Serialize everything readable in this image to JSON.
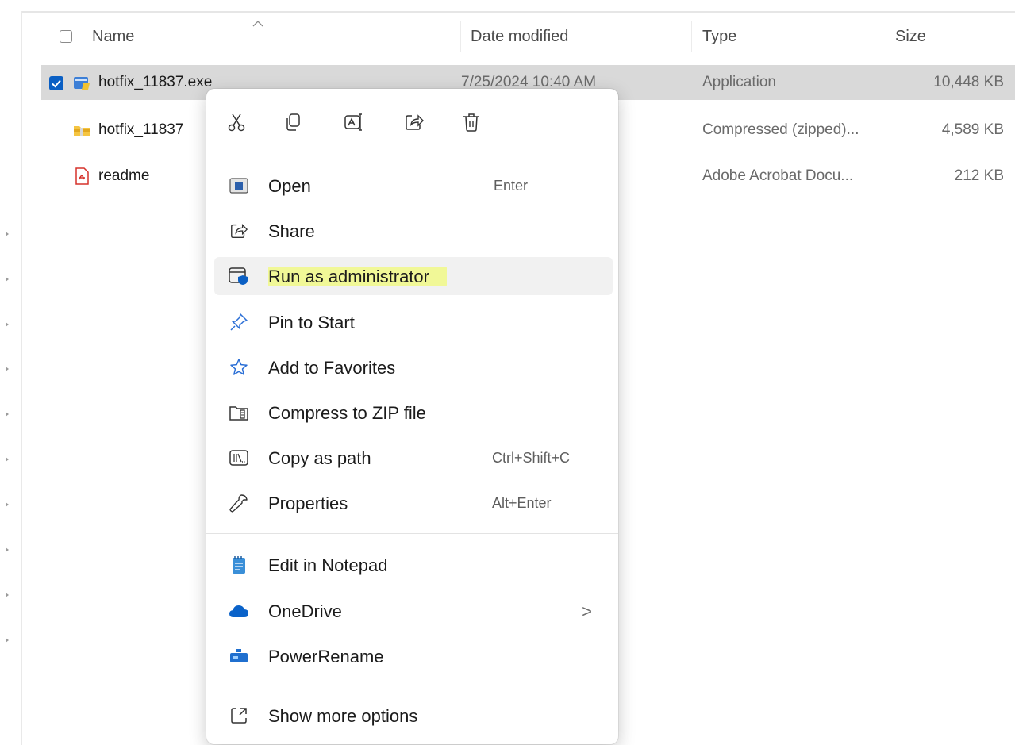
{
  "header": {
    "name": "Name",
    "date_modified": "Date modified",
    "type": "Type",
    "size": "Size"
  },
  "files": [
    {
      "name": "hotfix_11837.exe",
      "date": "7/25/2024 10:40 AM",
      "type": "Application",
      "size": "10,448 KB",
      "icon": "application-icon",
      "selected": true
    },
    {
      "name": "hotfix_11837",
      "date": "",
      "type": "Compressed (zipped)...",
      "size": "4,589 KB",
      "icon": "zip-folder-icon",
      "selected": false
    },
    {
      "name": "readme",
      "date": "",
      "type": "Adobe Acrobat Docu...",
      "size": "212 KB",
      "icon": "pdf-icon",
      "selected": false
    }
  ],
  "context_menu": {
    "quick_actions": [
      "cut-icon",
      "copy-icon",
      "rename-icon",
      "share-icon",
      "delete-icon"
    ],
    "items": [
      {
        "label": "Open",
        "shortcut": "Enter",
        "icon": "open-icon"
      },
      {
        "label": "Share",
        "shortcut": "",
        "icon": "share-icon"
      },
      {
        "label": "Run as administrator",
        "shortcut": "",
        "icon": "shield-window-icon",
        "highlighted": true
      },
      {
        "label": "Pin to Start",
        "shortcut": "",
        "icon": "pin-icon"
      },
      {
        "label": "Add to Favorites",
        "shortcut": "",
        "icon": "star-icon"
      },
      {
        "label": "Compress to ZIP file",
        "shortcut": "",
        "icon": "zip-icon"
      },
      {
        "label": "Copy as path",
        "shortcut": "Ctrl+Shift+C",
        "icon": "path-icon"
      },
      {
        "label": "Properties",
        "shortcut": "Alt+Enter",
        "icon": "wrench-icon"
      },
      {
        "label": "Edit in Notepad",
        "shortcut": "",
        "icon": "notepad-icon"
      },
      {
        "label": "OneDrive",
        "shortcut": "",
        "icon": "cloud-icon",
        "submenu_glyph": ">"
      },
      {
        "label": "PowerRename",
        "shortcut": "",
        "icon": "powerrename-icon"
      },
      {
        "label": "Show more options",
        "shortcut": "",
        "icon": "more-options-icon"
      }
    ]
  },
  "colors": {
    "selection": "#d9d9d9",
    "checkbox_accent": "#0a5fc4",
    "highlighter": "#f0fa78"
  }
}
